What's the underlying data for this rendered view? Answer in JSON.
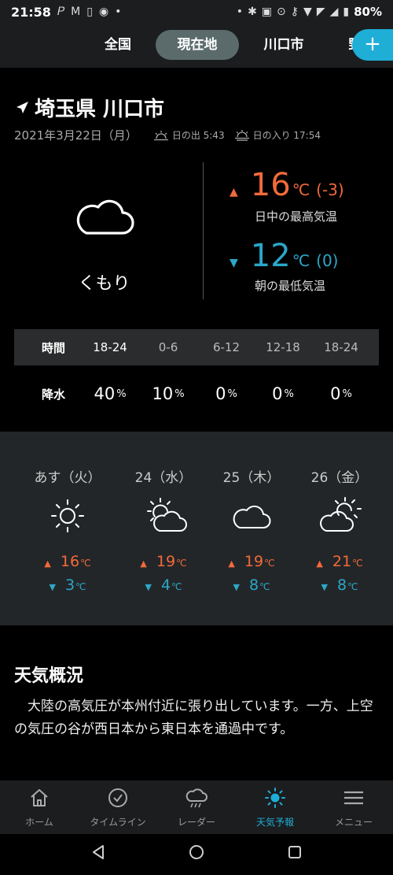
{
  "status_bar": {
    "time": "21:58",
    "battery": "80%"
  },
  "tabs": [
    {
      "label": "全国"
    },
    {
      "label": "現在地"
    },
    {
      "label": "川口市"
    },
    {
      "label": "野"
    }
  ],
  "plus_button": "+",
  "location": {
    "title": "埼玉県 川口市",
    "date": "2021年3月22日（月）",
    "sunrise": "日の出 5:43",
    "sunset": "日の入り 17:54"
  },
  "current": {
    "icon": "cloud-icon",
    "condition": "くもり",
    "high": {
      "value": "16",
      "unit": "℃",
      "diff": "(-3)",
      "caption": "日中の最高気温"
    },
    "low": {
      "value": "12",
      "unit": "℃",
      "diff": "(0)",
      "caption": "朝の最低気温"
    }
  },
  "precip": {
    "time_label": "時間",
    "rain_label": "降水",
    "periods": [
      "18-24",
      "0-6",
      "6-12",
      "12-18",
      "18-24"
    ],
    "values": [
      "40",
      "10",
      "0",
      "0",
      "0"
    ],
    "unit": "%"
  },
  "weekly": [
    {
      "day": "あす（火）",
      "icon": "sun-icon",
      "high": "16",
      "low": "3"
    },
    {
      "day": "24（水）",
      "icon": "sun-cloud-icon",
      "high": "19",
      "low": "4"
    },
    {
      "day": "25（木）",
      "icon": "cloud-icon",
      "high": "19",
      "low": "8"
    },
    {
      "day": "26（金）",
      "icon": "sun-cloud-icon",
      "high": "21",
      "low": "8"
    }
  ],
  "temp_unit": "℃",
  "up_arrow": "▲",
  "down_arrow": "▼",
  "overview": {
    "title": "天気概況",
    "text": "大陸の高気圧が本州付近に張り出しています。一方、上空の気圧の谷が西日本から東日本を通過中です。"
  },
  "bottom_nav": [
    {
      "label": "ホーム",
      "icon": "home-icon"
    },
    {
      "label": "タイムライン",
      "icon": "check-circle-icon"
    },
    {
      "label": "レーダー",
      "icon": "rain-cloud-icon"
    },
    {
      "label": "天気予報",
      "icon": "sun-icon"
    },
    {
      "label": "メニュー",
      "icon": "menu-icon"
    }
  ],
  "colors": {
    "accent": "#1faed6",
    "hot": "#f26a3b",
    "cold": "#2ba7c9"
  }
}
